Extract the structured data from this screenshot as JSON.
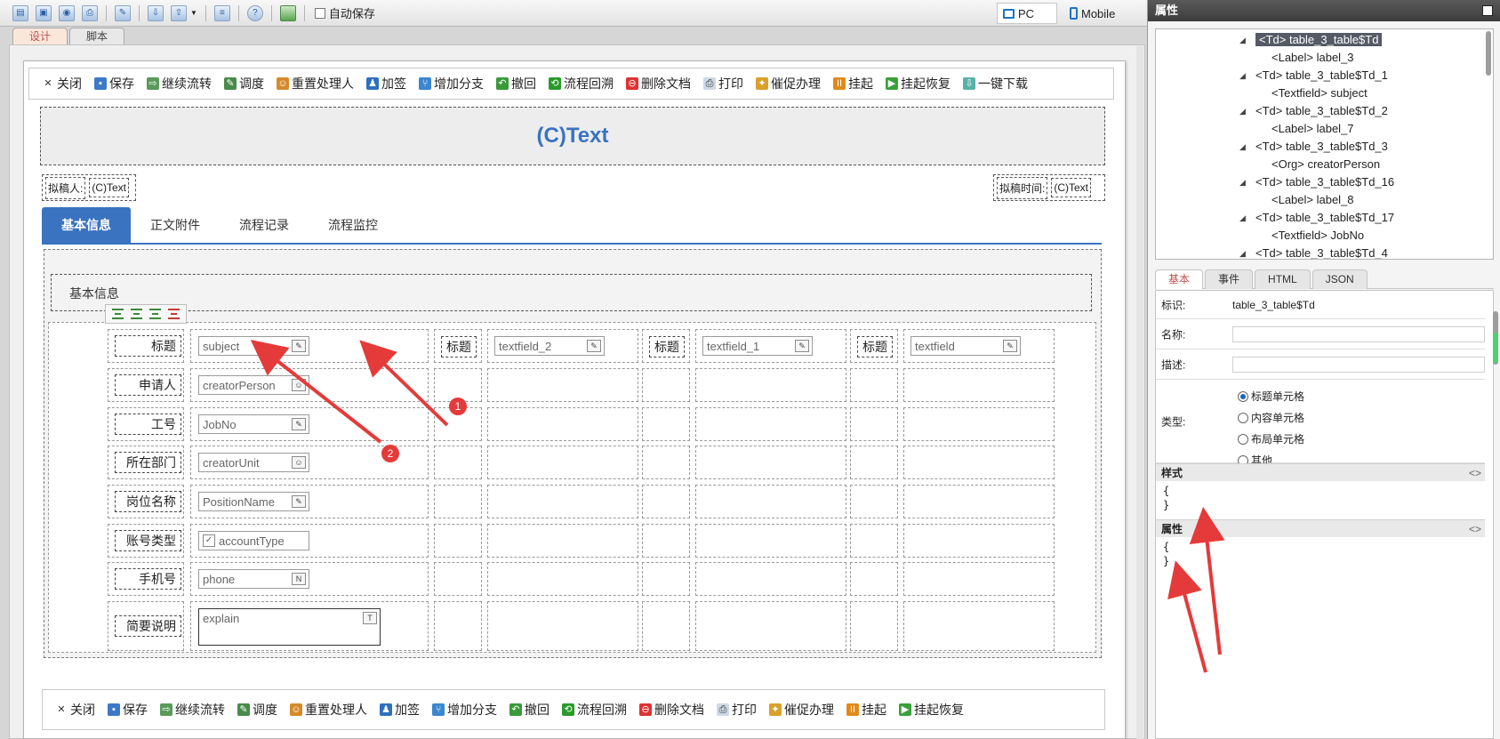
{
  "toolbar": {
    "autosave_label": "自动保存",
    "mode_pc": "PC",
    "mode_mobile": "Mobile"
  },
  "design_tabs": [
    "设计",
    "脚本"
  ],
  "actions_top": [
    "关闭",
    "保存",
    "继续流转",
    "调度",
    "重置处理人",
    "加签",
    "增加分支",
    "撤回",
    "流程回溯",
    "删除文档",
    "打印",
    "催促办理",
    "挂起",
    "挂起恢复",
    "一键下载"
  ],
  "actions_bottom": [
    "关闭",
    "保存",
    "继续流转",
    "调度",
    "重置处理人",
    "加签",
    "增加分支",
    "撤回",
    "流程回溯",
    "删除文档",
    "打印",
    "催促办理",
    "挂起",
    "挂起恢复"
  ],
  "form": {
    "title": "(C)Text",
    "drafter_label": "拟稿人:",
    "drafter_value": "(C)Text",
    "draft_time_label": "拟稿时间:",
    "draft_time_value": "(C)Text",
    "tabs": [
      "基本信息",
      "正文附件",
      "流程记录",
      "流程监控"
    ],
    "section_title": "基本信息",
    "rows": [
      {
        "label": "标题",
        "field": "subject"
      },
      {
        "label": "申请人",
        "field": "creatorPerson"
      },
      {
        "label": "工号",
        "field": "JobNo"
      },
      {
        "label": "所在部门",
        "field": "creatorUnit"
      },
      {
        "label": "岗位名称",
        "field": "PositionName"
      },
      {
        "label": "账号类型",
        "field": "accountType"
      },
      {
        "label": "手机号",
        "field": "phone"
      },
      {
        "label": "简要说明",
        "field": "explain"
      }
    ],
    "extra_row1": [
      {
        "label": "标题",
        "field": "textfield_2"
      },
      {
        "label": "标题",
        "field": "textfield_1"
      },
      {
        "label": "标题",
        "field": "textfield"
      }
    ]
  },
  "props": {
    "title": "属性",
    "tree": [
      {
        "text": "<Td> table_3_table$Td",
        "level": 1,
        "selected": true
      },
      {
        "text": "<Label> label_3",
        "level": 2
      },
      {
        "text": "<Td> table_3_table$Td_1",
        "level": 1
      },
      {
        "text": "<Textfield> subject",
        "level": 2
      },
      {
        "text": "<Td> table_3_table$Td_2",
        "level": 1
      },
      {
        "text": "<Label> label_7",
        "level": 2
      },
      {
        "text": "<Td> table_3_table$Td_3",
        "level": 1
      },
      {
        "text": "<Org> creatorPerson",
        "level": 2
      },
      {
        "text": "<Td> table_3_table$Td_16",
        "level": 1
      },
      {
        "text": "<Label> label_8",
        "level": 2
      },
      {
        "text": "<Td> table_3_table$Td_17",
        "level": 1
      },
      {
        "text": "<Textfield> JobNo",
        "level": 2
      },
      {
        "text": "<Td> table_3_table$Td_4",
        "level": 1
      }
    ],
    "tabs": [
      "基本",
      "事件",
      "HTML",
      "JSON"
    ],
    "id_label": "标识:",
    "id_value": "table_3_table$Td",
    "name_label": "名称:",
    "desc_label": "描述:",
    "type_label": "类型:",
    "type_options": [
      "标题单元格",
      "内容单元格",
      "布局单元格",
      "其他"
    ],
    "type_selected": 0,
    "style_header": "样式",
    "attr_header": "属性",
    "toggle_symbol": "<>",
    "brace_open": "{",
    "brace_close": "}"
  },
  "annotations": [
    "1",
    "2"
  ],
  "colors": {
    "accent_blue": "#3a73c0",
    "annotation_red": "#e53a3a"
  }
}
